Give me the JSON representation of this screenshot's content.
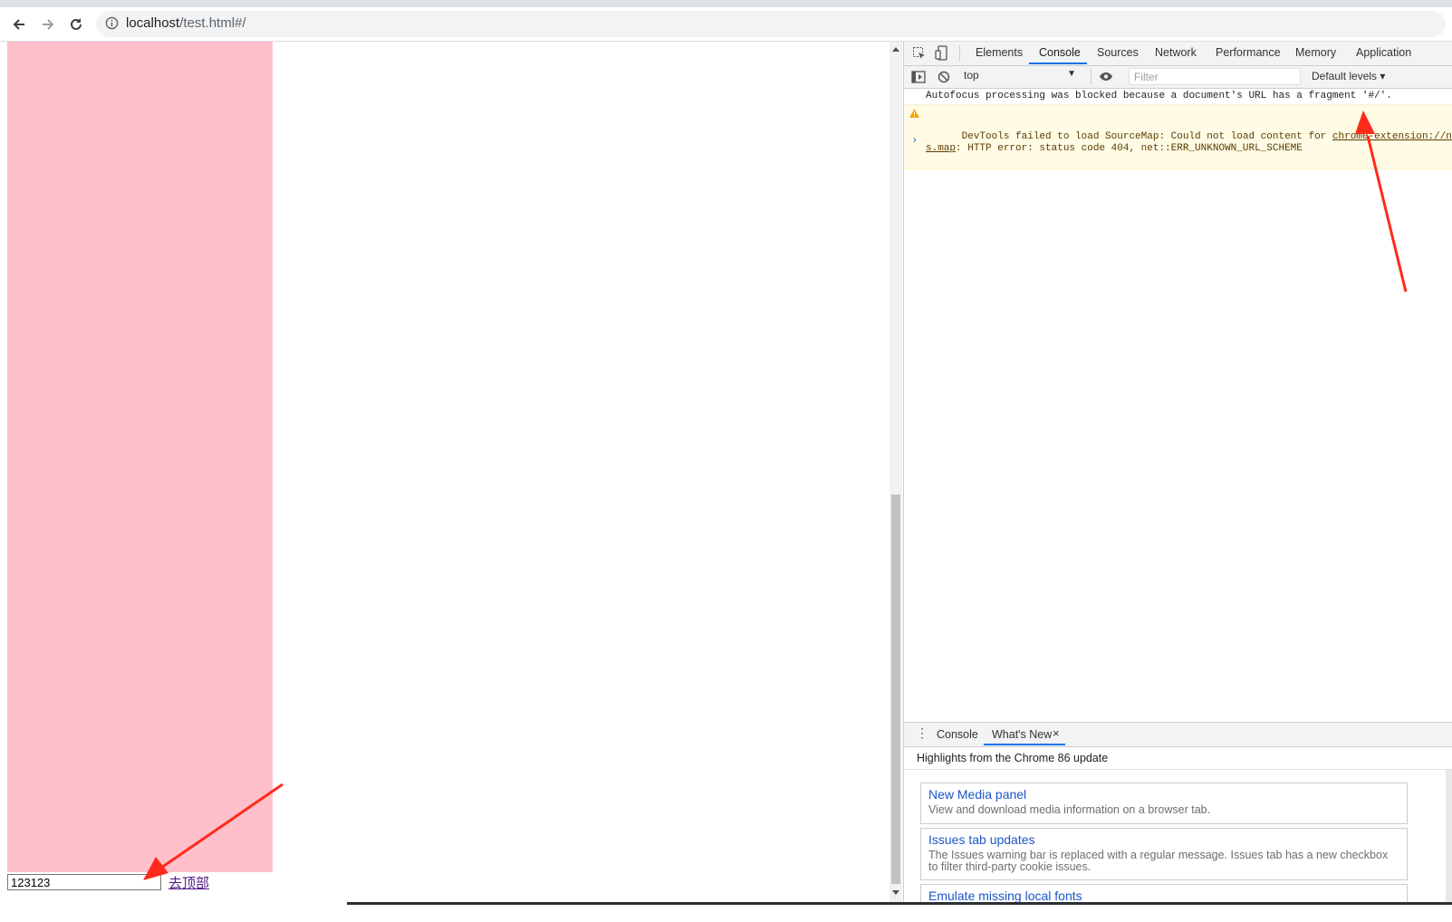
{
  "browser": {
    "url_host": "localhost",
    "url_path": "/test.html#/",
    "back_icon": "arrow-left-icon",
    "forward_icon": "arrow-right-icon",
    "reload_icon": "reload-icon",
    "info_icon": "info-icon"
  },
  "page": {
    "input_value": "123123",
    "link_text": "去顶部",
    "box_color": "#ffc0cb"
  },
  "devtools": {
    "tabs": [
      "Elements",
      "Console",
      "Sources",
      "Network",
      "Performance",
      "Memory",
      "Application"
    ],
    "active_tab": "Console",
    "context": "top",
    "filter_placeholder": "Filter",
    "levels": "Default levels ▾",
    "messages": [
      {
        "type": "info",
        "text": "Autofocus processing was blocked because a document's URL has a fragment '#/'."
      },
      {
        "type": "warning",
        "line1_prefix": "DevTools failed to load SourceMap: Could not load content for ",
        "line1_link": "chrome-extension://ncen",
        "line2_link": "s.map",
        "line2_rest": ": HTTP error: status code 404, net::ERR_UNKNOWN_URL_SCHEME"
      }
    ],
    "prompt": "›",
    "drawer": {
      "tabs": [
        "Console",
        "What's New"
      ],
      "active_tab": "What's New",
      "close_glyph": "×",
      "heading": "Highlights from the Chrome 86 update",
      "cards": [
        {
          "title": "New Media panel",
          "desc": "View and download media information on a browser tab."
        },
        {
          "title": "Issues tab updates",
          "desc": "The Issues warning bar is replaced with a regular message. Issues tab has a new checkbox to filter third-party cookie issues."
        },
        {
          "title": "Emulate missing local fonts",
          "desc": ""
        }
      ]
    }
  },
  "annotation_color": "#ff2a1a"
}
